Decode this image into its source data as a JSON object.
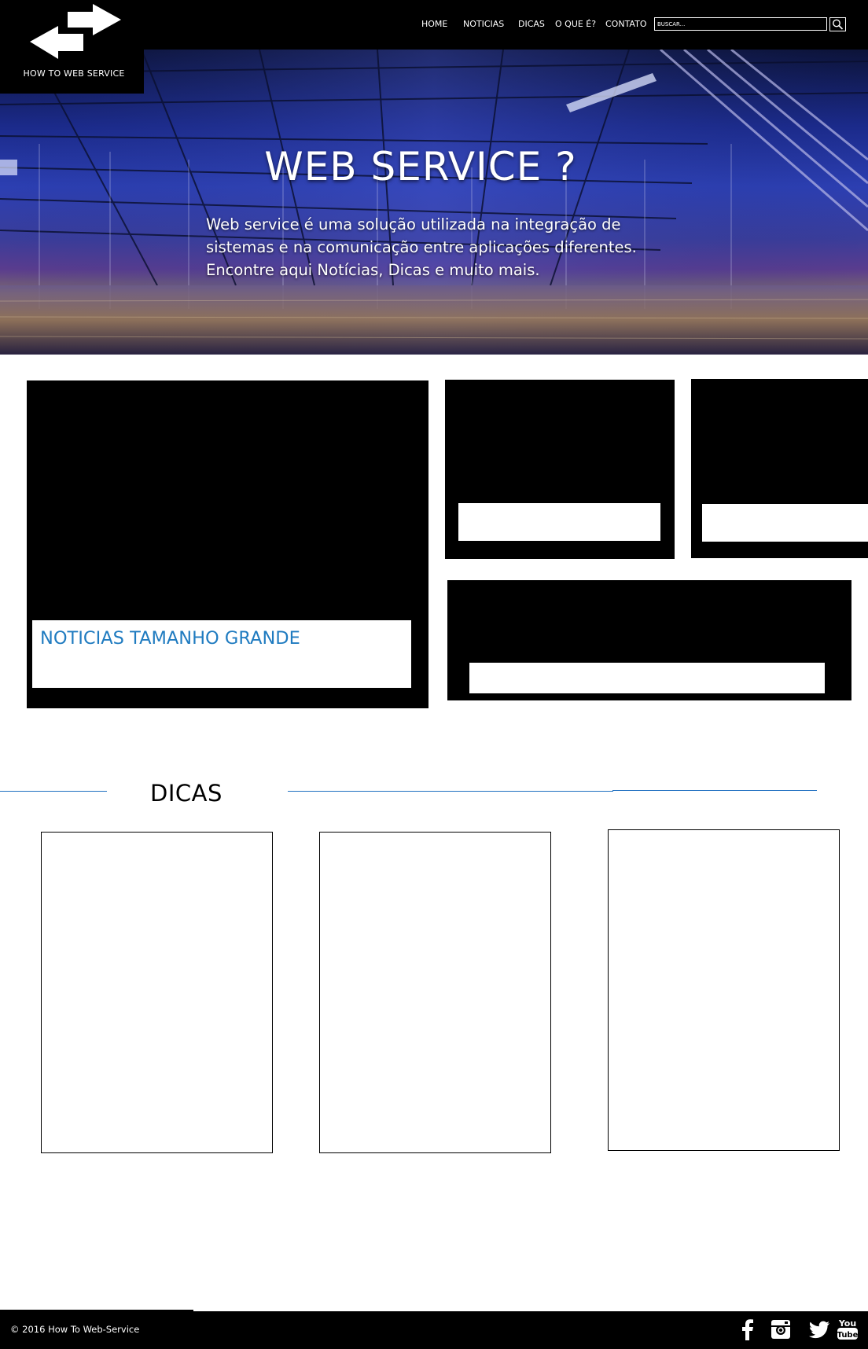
{
  "header": {
    "logo_text": "HOW TO WEB SERVICE",
    "nav": [
      {
        "label": "HOME"
      },
      {
        "label": "NOTICIAS"
      },
      {
        "label": "DICAS"
      },
      {
        "label": "O QUE É?"
      },
      {
        "label": "CONTATO"
      }
    ],
    "search": {
      "placeholder": "BUSCAR...",
      "button_icon": "search-icon"
    }
  },
  "hero": {
    "title": "WEB SERVICE ?",
    "lines": [
      "Web service é uma solução utilizada na integração de",
      "sistemas e na comunicação entre aplicações diferentes.",
      "Encontre aqui Notícias, Dicas e muito mais."
    ]
  },
  "news": {
    "big_title": "NOTICIAS TAMANHO GRANDE"
  },
  "dicas": {
    "title": "DICAS"
  },
  "footer": {
    "copyright": "© 2016 How To Web-Service",
    "social": [
      "facebook-icon",
      "instagram-icon",
      "twitter-icon",
      "youtube-icon"
    ]
  },
  "colors": {
    "accent": "#1f7bc0",
    "bar": "#000000"
  }
}
